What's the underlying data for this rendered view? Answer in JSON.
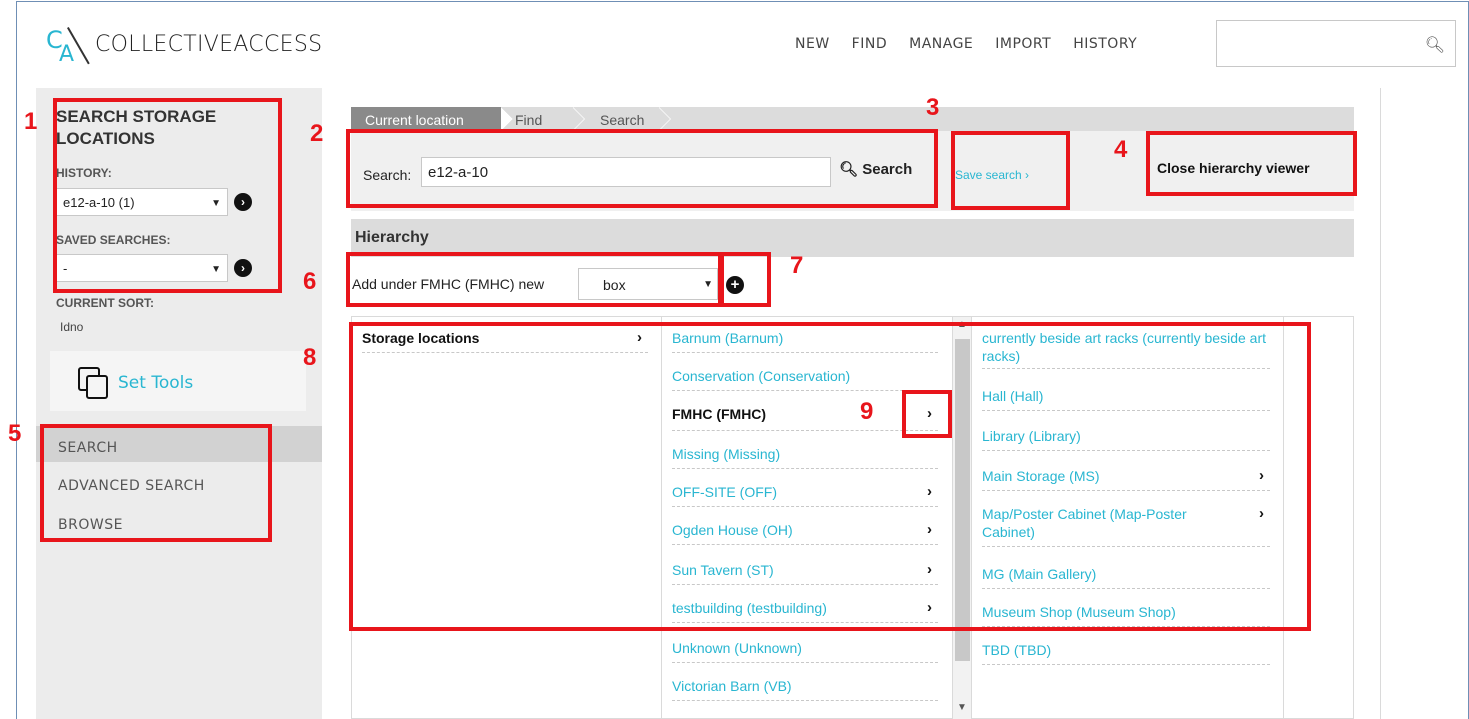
{
  "app": {
    "logo_text": "COLLECTIVEACCESS",
    "logo_c": "C",
    "logo_a": "A"
  },
  "topnav": {
    "items": [
      "NEW",
      "FIND",
      "MANAGE",
      "IMPORT",
      "HISTORY"
    ],
    "search_icon": "search-icon"
  },
  "sidebar": {
    "title": "SEARCH STORAGE LOCATIONS",
    "history_label": "HISTORY:",
    "history_value": "e12-a-10 (1)",
    "saved_label": "SAVED SEARCHES:",
    "saved_value": "-",
    "sort_label": "CURRENT SORT:",
    "sort_value": "Idno",
    "set_tools": "Set Tools",
    "nav": [
      "SEARCH",
      "ADVANCED SEARCH",
      "BROWSE"
    ]
  },
  "breadcrumb": [
    "Current location",
    "Find",
    "Search"
  ],
  "search": {
    "label": "Search:",
    "value": "e12-a-10",
    "button": "Search",
    "save_search": "Save search ›",
    "close_hierarchy": "Close hierarchy viewer"
  },
  "hierarchy": {
    "title": "Hierarchy",
    "add_under": "Add under FMHC (FMHC) new",
    "add_type": "box",
    "col1": [
      {
        "label": "Storage locations",
        "has_children": true
      }
    ],
    "col2": [
      {
        "label": "Barnum (Barnum)",
        "has_children": false
      },
      {
        "label": "Conservation (Conservation)",
        "has_children": false
      },
      {
        "label": "FMHC (FMHC)",
        "has_children": true
      },
      {
        "label": "Missing (Missing)",
        "has_children": false
      },
      {
        "label": "OFF-SITE (OFF)",
        "has_children": true
      },
      {
        "label": "Ogden House (OH)",
        "has_children": true
      },
      {
        "label": "Sun Tavern (ST)",
        "has_children": true
      },
      {
        "label": "testbuilding (testbuilding)",
        "has_children": true
      },
      {
        "label": "Unknown (Unknown)",
        "has_children": false
      },
      {
        "label": "Victorian Barn (VB)",
        "has_children": false
      }
    ],
    "col3": [
      {
        "label": "currently beside art racks (currently beside art racks)",
        "has_children": false
      },
      {
        "label": "Hall (Hall)",
        "has_children": false
      },
      {
        "label": "Library (Library)",
        "has_children": false
      },
      {
        "label": "Main Storage (MS)",
        "has_children": true
      },
      {
        "label": "Map/Poster Cabinet (Map-Poster Cabinet)",
        "has_children": true
      },
      {
        "label": "MG (Main Gallery)",
        "has_children": false
      },
      {
        "label": "Museum Shop (Museum Shop)",
        "has_children": false
      },
      {
        "label": "TBD (TBD)",
        "has_children": false
      }
    ]
  },
  "annotations": {
    "labels": [
      "1",
      "2",
      "3",
      "4",
      "5",
      "6",
      "7",
      "8",
      "9"
    ],
    "color": "#e8151b"
  },
  "colors": {
    "accent": "#29b6d1",
    "sidebar_bg": "#ececec"
  }
}
